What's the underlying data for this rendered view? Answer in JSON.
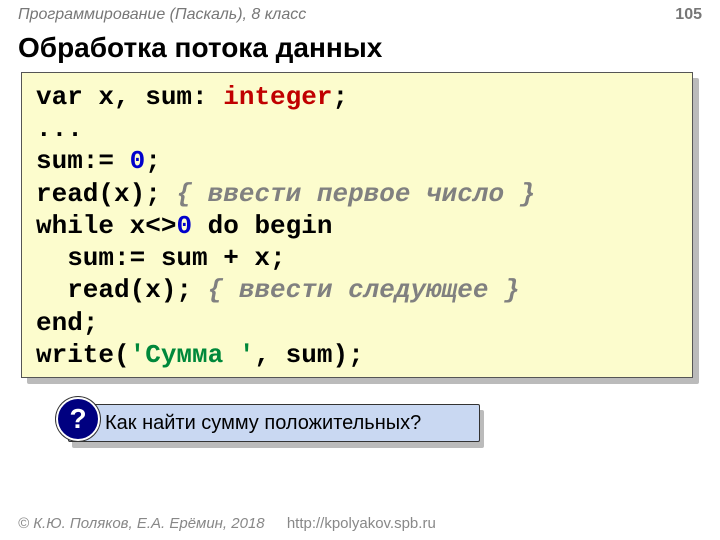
{
  "header": {
    "course": "Программирование (Паскаль), 8 класс",
    "page": "105"
  },
  "title": "Обработка потока данных",
  "code": {
    "l1a": "var x, sum: ",
    "l1b": "integer",
    "l1c": ";",
    "l2": "...",
    "l3a": "sum:= ",
    "l3b": "0",
    "l3c": ";",
    "l4a": "read(x); ",
    "l4b": "{ ввести первое число }",
    "l5a": "while x<>",
    "l5b": "0",
    "l5c": " do begin",
    "l6": "  sum:= sum + x;",
    "l7a": "  read(x); ",
    "l7b": "{ ввести следующее }",
    "l8": "end;",
    "l9a": "write(",
    "l9b": "'Сумма '",
    "l9c": ", sum);"
  },
  "question": {
    "badge": "?",
    "text": "Как найти сумму положительных?"
  },
  "footer": {
    "authors": "© К.Ю. Поляков, Е.А. Ерёмин, 2018",
    "url": "http://kpolyakov.spb.ru"
  }
}
